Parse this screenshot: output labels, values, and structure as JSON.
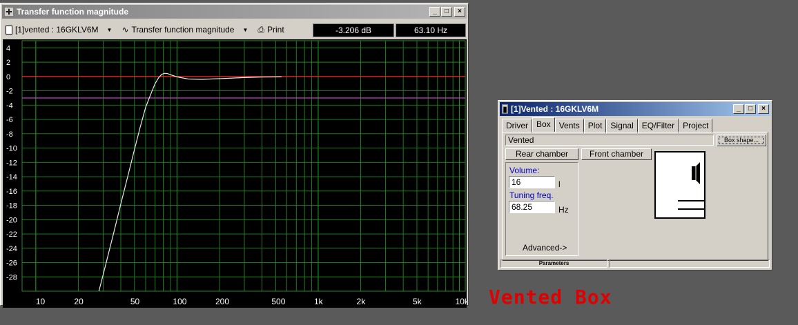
{
  "tf_window": {
    "title": "Transfer function magnitude",
    "project_select": "[1]vented : 16GKLV6M",
    "curve_select": "Transfer function magnitude",
    "print_label": "Print",
    "readout_db": "-3.206 dB",
    "readout_hz": "63.10 Hz"
  },
  "chart_data": {
    "type": "line",
    "x_scale": "log",
    "xlim": [
      8,
      11000
    ],
    "ylim": [
      -30,
      5
    ],
    "x_tick_labels": [
      {
        "v": 10,
        "t": "10"
      },
      {
        "v": 20,
        "t": "20"
      },
      {
        "v": 50,
        "t": "50"
      },
      {
        "v": 100,
        "t": "100"
      },
      {
        "v": 200,
        "t": "200"
      },
      {
        "v": 500,
        "t": "500"
      },
      {
        "v": 1000,
        "t": "1k"
      },
      {
        "v": 2000,
        "t": "2k"
      },
      {
        "v": 5000,
        "t": "5k"
      },
      {
        "v": 10000,
        "t": "10k"
      }
    ],
    "y_ticks": [
      4,
      2,
      0,
      -2,
      -4,
      -6,
      -8,
      -10,
      -12,
      -14,
      -16,
      -18,
      -20,
      -22,
      -24,
      -26,
      -28
    ],
    "grid": true,
    "reference_lines": [
      {
        "y": 0,
        "color": "#ff2020"
      },
      {
        "y": -3,
        "color": "#c040c0"
      }
    ],
    "series": [
      {
        "color": "#e8e8e8",
        "x": [
          28,
          32,
          36,
          40,
          45,
          50,
          55,
          60,
          63.1,
          66,
          70,
          74,
          78,
          82,
          86,
          90,
          100,
          120,
          150,
          200,
          300,
          400,
          550
        ],
        "y": [
          -30,
          -25.5,
          -21.5,
          -17.8,
          -13.8,
          -10.2,
          -7.0,
          -4.3,
          -3.2,
          -2.2,
          -1.0,
          -0.2,
          0.3,
          0.45,
          0.4,
          0.25,
          -0.05,
          -0.35,
          -0.4,
          -0.3,
          -0.15,
          -0.08,
          -0.05
        ]
      }
    ]
  },
  "params_window": {
    "title": "[1]Vented : 16GKLV6M",
    "tabs": [
      "Driver",
      "Box",
      "Vents",
      "Plot",
      "Signal",
      "EQ/Filter",
      "Project"
    ],
    "selected_tab": "Box",
    "box_type": "Vented",
    "box_shape_button": "Box shape...",
    "rear_chamber_button": "Rear chamber",
    "front_chamber_button": "Front chamber",
    "volume_label": "Volume:",
    "volume_value": "16",
    "volume_unit": "l",
    "tuning_label": "Tuning freq.",
    "tuning_value": "68.25",
    "tuning_unit": "Hz",
    "advanced_label": "Advanced->",
    "status_parameters": "Parameters"
  },
  "caption": "Vented Box"
}
